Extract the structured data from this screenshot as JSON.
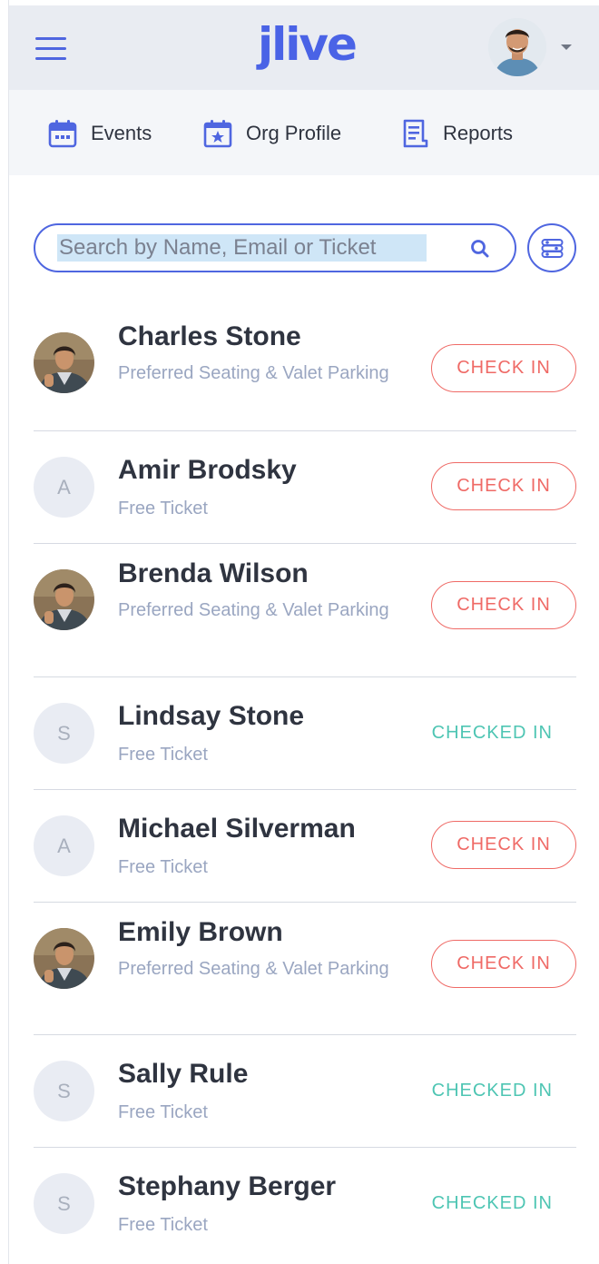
{
  "header": {
    "logo_text": "jlive",
    "menu_icon": "hamburger-icon",
    "avatar": "user-avatar",
    "caret_icon": "caret-down-icon"
  },
  "nav": {
    "items": [
      {
        "label": "Events",
        "icon": "calendar-icon"
      },
      {
        "label": "Org Profile",
        "icon": "star-calendar-icon"
      },
      {
        "label": "Reports",
        "icon": "report-icon"
      }
    ]
  },
  "search": {
    "placeholder": "Search by Name, Email or Ticket",
    "search_icon": "search-icon",
    "filter_icon": "filter-icon"
  },
  "colors": {
    "accent": "#4f66e0",
    "check_in": "#ef6a66",
    "checked_in": "#4ec5b3",
    "ticket_text": "#9aa6c1"
  },
  "attendees": [
    {
      "name": "Charles Stone",
      "ticket": "Preferred Seating & Valet Parking",
      "avatar": "photo",
      "initial": "",
      "status": "CHECK IN"
    },
    {
      "name": "Amir Brodsky",
      "ticket": "Free Ticket",
      "avatar": "initial",
      "initial": "A",
      "status": "CHECK IN"
    },
    {
      "name": "Brenda Wilson",
      "ticket": "Preferred Seating & Valet Parking",
      "avatar": "photo",
      "initial": "",
      "status": "CHECK IN"
    },
    {
      "name": "Lindsay Stone",
      "ticket": "Free Ticket",
      "avatar": "initial",
      "initial": "S",
      "status": "CHECKED IN"
    },
    {
      "name": "Michael Silverman",
      "ticket": "Free Ticket",
      "avatar": "initial",
      "initial": "A",
      "status": "CHECK IN"
    },
    {
      "name": "Emily Brown",
      "ticket": "Preferred Seating & Valet Parking",
      "avatar": "photo",
      "initial": "",
      "status": "CHECK IN"
    },
    {
      "name": "Sally Rule",
      "ticket": "Free Ticket",
      "avatar": "initial",
      "initial": "S",
      "status": "CHECKED IN"
    },
    {
      "name": "Stephany Berger",
      "ticket": "Free Ticket",
      "avatar": "initial",
      "initial": "S",
      "status": "CHECKED IN"
    }
  ]
}
